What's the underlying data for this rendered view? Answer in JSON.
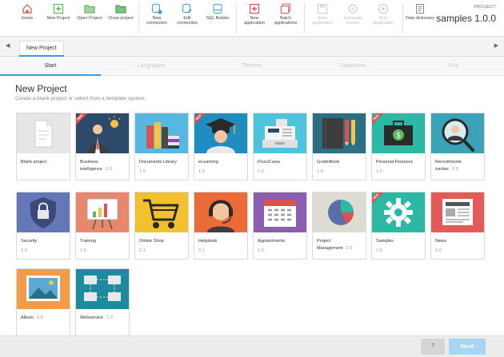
{
  "toolbar": {
    "buttons": [
      {
        "label": "Home",
        "enabled": true
      },
      {
        "label": "New Project",
        "enabled": true
      },
      {
        "label": "Open Project",
        "enabled": true
      },
      {
        "label": "Close project",
        "enabled": true
      },
      {
        "label": "New connection",
        "enabled": true
      },
      {
        "label": "Edit connection",
        "enabled": true
      },
      {
        "label": "SQL Builder",
        "enabled": true
      },
      {
        "label": "New application",
        "enabled": true
      },
      {
        "label": "Batch applications",
        "enabled": true
      },
      {
        "label": "Save application",
        "enabled": false
      },
      {
        "label": "Generate source",
        "enabled": false
      },
      {
        "label": "Run application",
        "enabled": false
      },
      {
        "label": "Data dictionary",
        "enabled": true
      }
    ],
    "project_label": "PROJECT",
    "project_value": "samples 1.0.0"
  },
  "tabs": {
    "active": "New Project",
    "prev_arrow": "◀",
    "next_arrow": "▶"
  },
  "wizard": {
    "steps": [
      "Start",
      "Languages",
      "Themes",
      "Databases",
      "End"
    ],
    "active_step": "Start"
  },
  "main": {
    "title": "New Project",
    "subtitle": "Create a blank project or select from a template system."
  },
  "templates": [
    {
      "name": "Blank project",
      "version": "",
      "badge": false,
      "bg": "#e6e6e6"
    },
    {
      "name": "Business intelligence",
      "version": "1.0",
      "badge": true,
      "bg": "#2d4a6b"
    },
    {
      "name": "Documents Library",
      "version": "1.0",
      "badge": false,
      "bg": "#55b8e3"
    },
    {
      "name": "eLearning",
      "version": "1.0",
      "badge": true,
      "bg": "#1f8dbf"
    },
    {
      "name": "FluxoCaixa",
      "version": "1.0",
      "badge": false,
      "bg": "#4ec3dd"
    },
    {
      "name": "GradeBook",
      "version": "1.0",
      "badge": false,
      "bg": "#2b6f85"
    },
    {
      "name": "Personal Finances",
      "version": "1.0",
      "badge": true,
      "bg": "#2db8a6"
    },
    {
      "name": "Recruitments tracker",
      "version": "2.0",
      "badge": false,
      "bg": "#3aa3b8"
    },
    {
      "name": "Security",
      "version": "2.0",
      "badge": false,
      "bg": "#6478b8"
    },
    {
      "name": "Training",
      "version": "1.0",
      "badge": false,
      "bg": "#e9876c"
    },
    {
      "name": "Online Shop",
      "version": "2.1",
      "badge": false,
      "bg": "#f2c12e"
    },
    {
      "name": "Helpdesk",
      "version": "2.1",
      "badge": false,
      "bg": "#eb6b38"
    },
    {
      "name": "Appointments",
      "version": "1.0",
      "badge": false,
      "bg": "#8c5eb0"
    },
    {
      "name": "Project Management",
      "version": "2.0",
      "badge": false,
      "bg": "#dcdcd2"
    },
    {
      "name": "Samples",
      "version": "2.0",
      "badge": true,
      "bg": "#2db8a6"
    },
    {
      "name": "News",
      "version": "2.0",
      "badge": false,
      "bg": "#e25b56"
    },
    {
      "name": "Album",
      "version": "2.0",
      "badge": false,
      "bg": "#f29b48"
    },
    {
      "name": "Webservice",
      "version": "1.0",
      "badge": false,
      "bg": "#1d8a9e"
    }
  ],
  "footer": {
    "help_label": "?",
    "next_label": "Next"
  },
  "colors": {
    "accent": "#3a9bd5",
    "badge": "#d9534f",
    "next_button": "#a8d5ef"
  }
}
